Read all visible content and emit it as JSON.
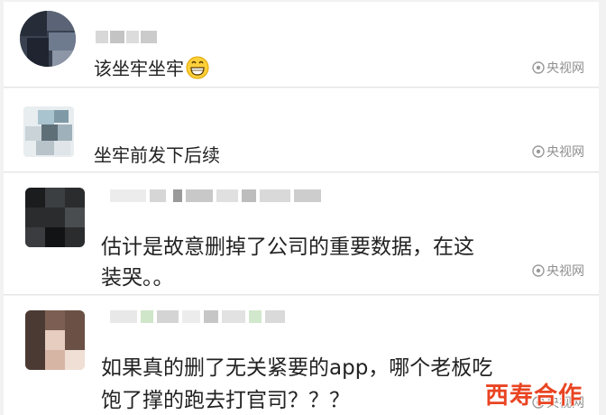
{
  "comments": [
    {
      "text": "该坐牢坐牢",
      "emoji": "grinning-face-emoji",
      "source": "央视网"
    },
    {
      "text": "坐牢前发下后续",
      "source": "央视网"
    },
    {
      "text_line1": "估计是故意删掉了公司的重要数据，在这",
      "text_line2": "装哭。。",
      "source": "央视网"
    },
    {
      "text_line1": "如果真的删了无关紧要的app，哪个老板吃",
      "text_line2": "饱了撑的跑去打官司？？？",
      "source": "央视网"
    }
  ],
  "site_logo": {
    "text": "西寿合作",
    "color": "#e94422"
  }
}
